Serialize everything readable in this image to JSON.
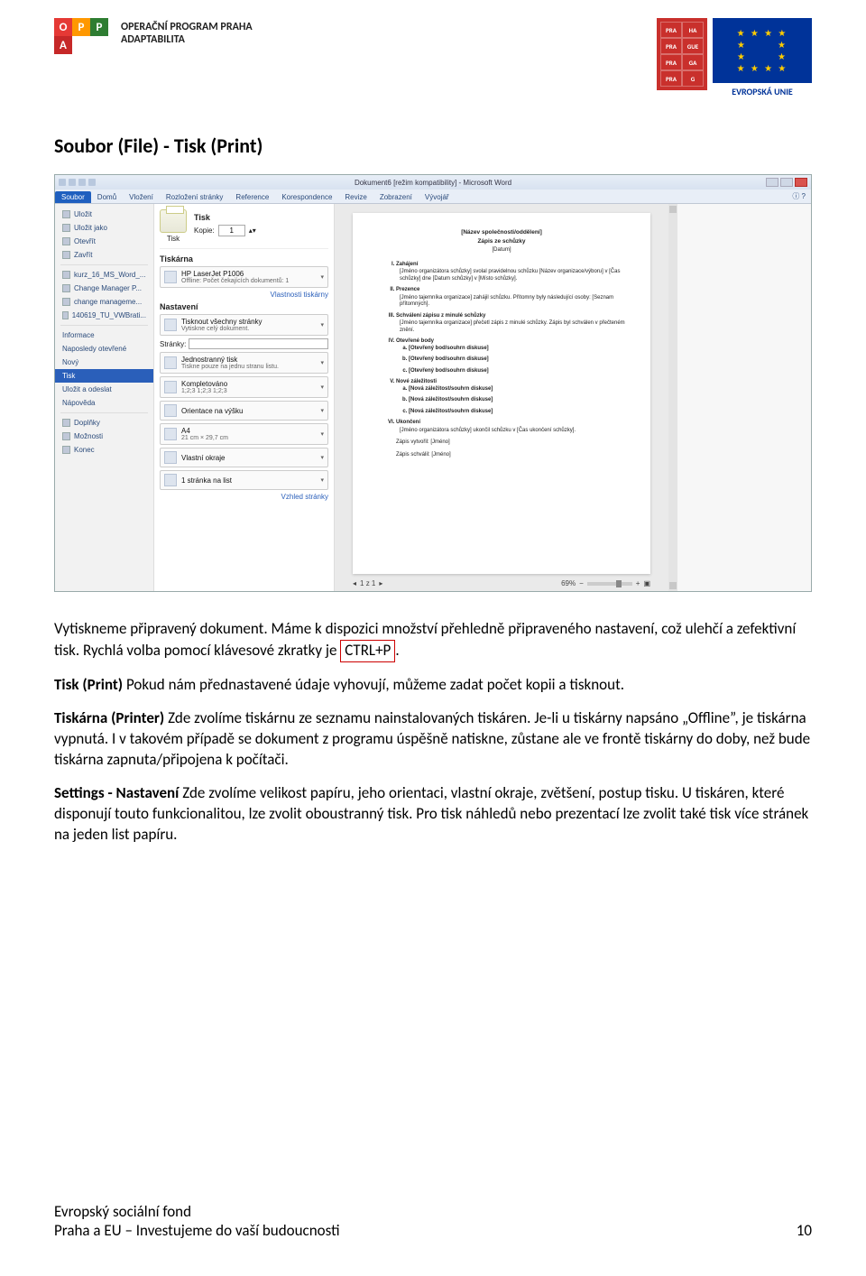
{
  "header": {
    "program_line1": "OPERAČNÍ PROGRAM PRAHA",
    "program_line2": "ADAPTABILITA",
    "oppa_letters": [
      "O",
      "P",
      "P",
      "A"
    ],
    "praha_grid": [
      [
        "PRA",
        "HA"
      ],
      [
        "PRA",
        "GUE"
      ],
      [
        "PRA",
        "GA"
      ],
      [
        "PRA",
        "G"
      ]
    ],
    "eu_text": "EVROPSKÁ UNIE"
  },
  "title": "Soubor (File) - Tisk (Print)",
  "word_window": {
    "title": "Dokument6 [režim kompatibility] - Microsoft Word",
    "tabs": [
      "Soubor",
      "Domů",
      "Vložení",
      "Rozložení stránky",
      "Reference",
      "Korespondence",
      "Revize",
      "Zobrazení",
      "Vývojář"
    ],
    "backstage_left": {
      "save": "Uložit",
      "saveas": "Uložit jako",
      "open": "Otevřít",
      "close": "Zavřít",
      "recent": [
        "kurz_16_MS_Word_...",
        "Change Manager P...",
        "change manageme...",
        "140619_TU_VWBrati..."
      ],
      "info": "Informace",
      "recent_label": "Naposledy otevřené",
      "new": "Nový",
      "print": "Tisk",
      "share": "Uložit a odeslat",
      "help": "Nápověda",
      "addins": "Doplňky",
      "options": "Možnosti",
      "exit": "Konec"
    },
    "print_pane": {
      "heading": "Tisk",
      "copies_label": "Kopie:",
      "copies_value": "1",
      "print_button": "Tisk",
      "printer_section": "Tiskárna",
      "printer_name": "HP LaserJet P1006",
      "printer_status": "Offline: Počet čekajících dokumentů: 1",
      "printer_props": "Vlastnosti tiskárny",
      "settings_section": "Nastavení",
      "scope_t1": "Tisknout všechny stránky",
      "scope_t2": "Vytiskne celý dokument.",
      "pages_label": "Stránky:",
      "sides_t1": "Jednostranný tisk",
      "sides_t2": "Tiskne pouze na jednu stranu listu.",
      "collate_t1": "Kompletováno",
      "collate_t2": "1;2;3   1;2;3   1;2;3",
      "orient_t1": "Orientace na výšku",
      "size_t1": "A4",
      "size_t2": "21 cm × 29,7 cm",
      "margins_t1": "Vlastní okraje",
      "persheet_t1": "1 stránka na list",
      "pagesetup": "Vzhled stránky"
    },
    "preview": {
      "doc_title": "[Název společnosti/oddělení]",
      "doc_subtitle": "Zápis ze schůzky",
      "doc_date": "[Datum]",
      "items": [
        {
          "h": "Zahájení",
          "s": "[Jméno organizátora schůzky] svolal pravidelnou schůzku [Název organizace/výboru] v [Čas schůzky] dne [Datum schůzky] v [Místo schůzky]."
        },
        {
          "h": "Prezence",
          "s": "[Jméno tajemníka organizace] zahájil schůzku. Přítomny byly následující osoby: [Seznam přítomných]."
        },
        {
          "h": "Schválení zápisu z minulé schůzky",
          "s": "[Jméno tajemníka organizace] přečetl zápis z minulé schůzky. Zápis byl schválen v přečteném znění."
        },
        {
          "h": "Otevřené body",
          "list": [
            "[Otevřený bod/souhrn diskuse]",
            "[Otevřený bod/souhrn diskuse]",
            "[Otevřený bod/souhrn diskuse]"
          ]
        },
        {
          "h": "Nové záležitosti",
          "list": [
            "[Nová záležitost/souhrn diskuse]",
            "[Nová záležitost/souhrn diskuse]",
            "[Nová záležitost/souhrn diskuse]"
          ]
        },
        {
          "h": "Ukončení",
          "s": "[Jméno organizátora schůzky] ukončil schůzku v [Čas ukončení schůzky]."
        }
      ],
      "foot1": "Zápis vytvořil:  [Jméno]",
      "foot2": "Zápis schválil:  [Jméno]",
      "page_nav": "1  z 1",
      "zoom": "69%"
    }
  },
  "paragraphs": {
    "p1a": "Vytiskneme připravený dokument. Máme k dispozici množství přehledně připraveného nastavení, což ulehčí a zefektivní tisk. Rychlá volba pomocí klávesové zkratky je ",
    "p1_kbd": "CTRL+P",
    "p1b": ".",
    "p2_bold": "Tisk (Print) ",
    "p2_rest": "Pokud nám přednastavené údaje vyhovují, můžeme zadat počet kopii a tisknout.",
    "p3_bold": "Tiskárna (Printer) ",
    "p3_rest": "Zde zvolíme tiskárnu ze seznamu nainstalovaných tiskáren. Je-li u tiskárny napsáno „Offline”, je tiskárna vypnutá. I v takovém případě se dokument z programu úspěšně natiskne, zůstane ale ve frontě tiskárny do doby, než bude tiskárna zapnuta/připojena k počítači.",
    "p4_bold": "Settings - Nastavení ",
    "p4_rest": "Zde zvolíme velikost papíru, jeho orientaci, vlastní okraje, zvětšení, postup tisku. U tiskáren, které disponují touto funkcionalitou, lze zvolit oboustranný tisk. Pro tisk náhledů nebo prezentací lze zvolit také tisk více stránek na jeden list papíru."
  },
  "footer": {
    "line1": "Evropský sociální fond",
    "line2": "Praha a EU – Investujeme do vaší budoucnosti",
    "page_num": "10"
  }
}
